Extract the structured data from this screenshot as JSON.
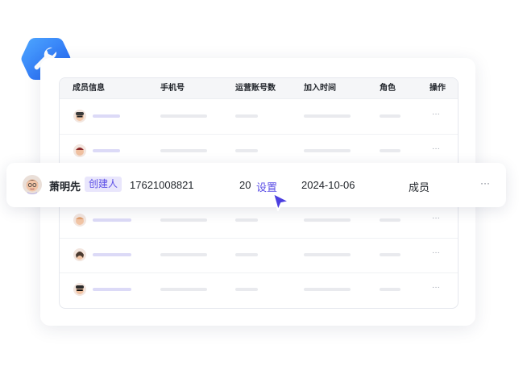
{
  "table": {
    "headers": [
      "成员信息",
      "手机号",
      "运营账号数",
      "加入时间",
      "角色",
      "操作"
    ],
    "row_action": "···"
  },
  "highlight": {
    "name": "萧明先",
    "badge": "创建人",
    "phone": "17621008821",
    "account_count": "20",
    "settings_link": "设置",
    "join_date": "2024-10-06",
    "role": "成员",
    "more": "···"
  },
  "colors": {
    "accent": "#5b4ee6",
    "badge_bg": "#e9e6fc",
    "logo_blue": "#2f7cf6"
  },
  "icons": [
    "wrench-icon",
    "pointer-cursor-icon",
    "avatar"
  ]
}
